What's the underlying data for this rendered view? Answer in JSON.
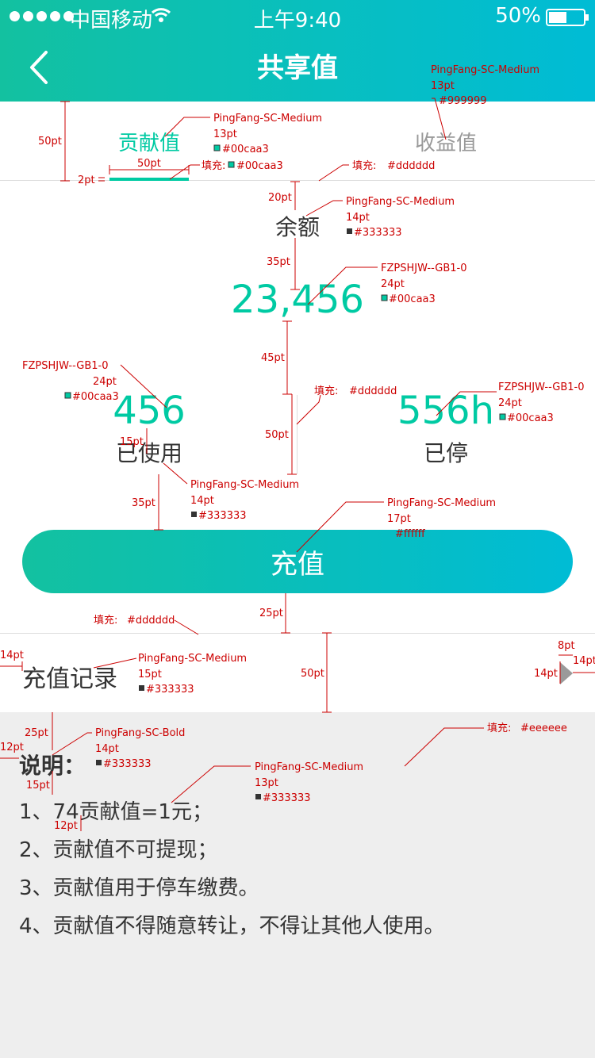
{
  "status_bar": {
    "carrier": "中国移动",
    "time": "上午9:40",
    "battery": "50%"
  },
  "nav": {
    "title": "共享值"
  },
  "tabs": [
    {
      "label": "贡献值"
    },
    {
      "label": "收益值"
    }
  ],
  "balance": {
    "label": "余额",
    "value": "23,456"
  },
  "stats": {
    "used": {
      "value": "456",
      "label": "已使用"
    },
    "parked": {
      "value": "556h",
      "label": "已停"
    }
  },
  "topup_button": {
    "label": "充值"
  },
  "record": {
    "label": "充值记录"
  },
  "notes": {
    "title": "说明：",
    "items": [
      "1、74贡献值=1元；",
      "2、贡献值不可提现；",
      "3、贡献值用于停车缴费。",
      "4、贡献值不得随意转让，不得让其他人使用。"
    ]
  },
  "annotations": {
    "font_medium": "PingFang-SC-Medium",
    "font_bold": "PingFang-SC-Bold",
    "font_digits": "FZPSHJW--GB1-0",
    "fill_prefix": "填充:",
    "size_13": "13pt",
    "size_14": "14pt",
    "size_15": "15pt",
    "size_17": "17pt",
    "size_24": "24pt",
    "c_999": "#999999",
    "c_00caa3": "#00caa3",
    "c_333": "#333333",
    "c_fff": "#ffffff",
    "c_ddd": "#dddddd",
    "c_eee": "#eeeeee",
    "d_50": "50pt",
    "d_2": "2pt",
    "d_20": "20pt",
    "d_35": "35pt",
    "d_45": "45pt",
    "d_15": "15pt",
    "d_25": "25pt",
    "d_14": "14pt",
    "d_8": "8pt",
    "d_12": "12pt"
  },
  "colors": {
    "accent": "#00caa3",
    "gradient_end": "#00bcd5",
    "text": "#333333",
    "muted": "#999999",
    "divider": "#dddddd",
    "background_notes": "#eeeeee"
  },
  "icons": {
    "back": "chevron-left-icon",
    "arrow": "chevron-right-icon",
    "wifi": "wifi-icon",
    "battery": "battery-icon",
    "signal": "signal-dots-icon"
  }
}
